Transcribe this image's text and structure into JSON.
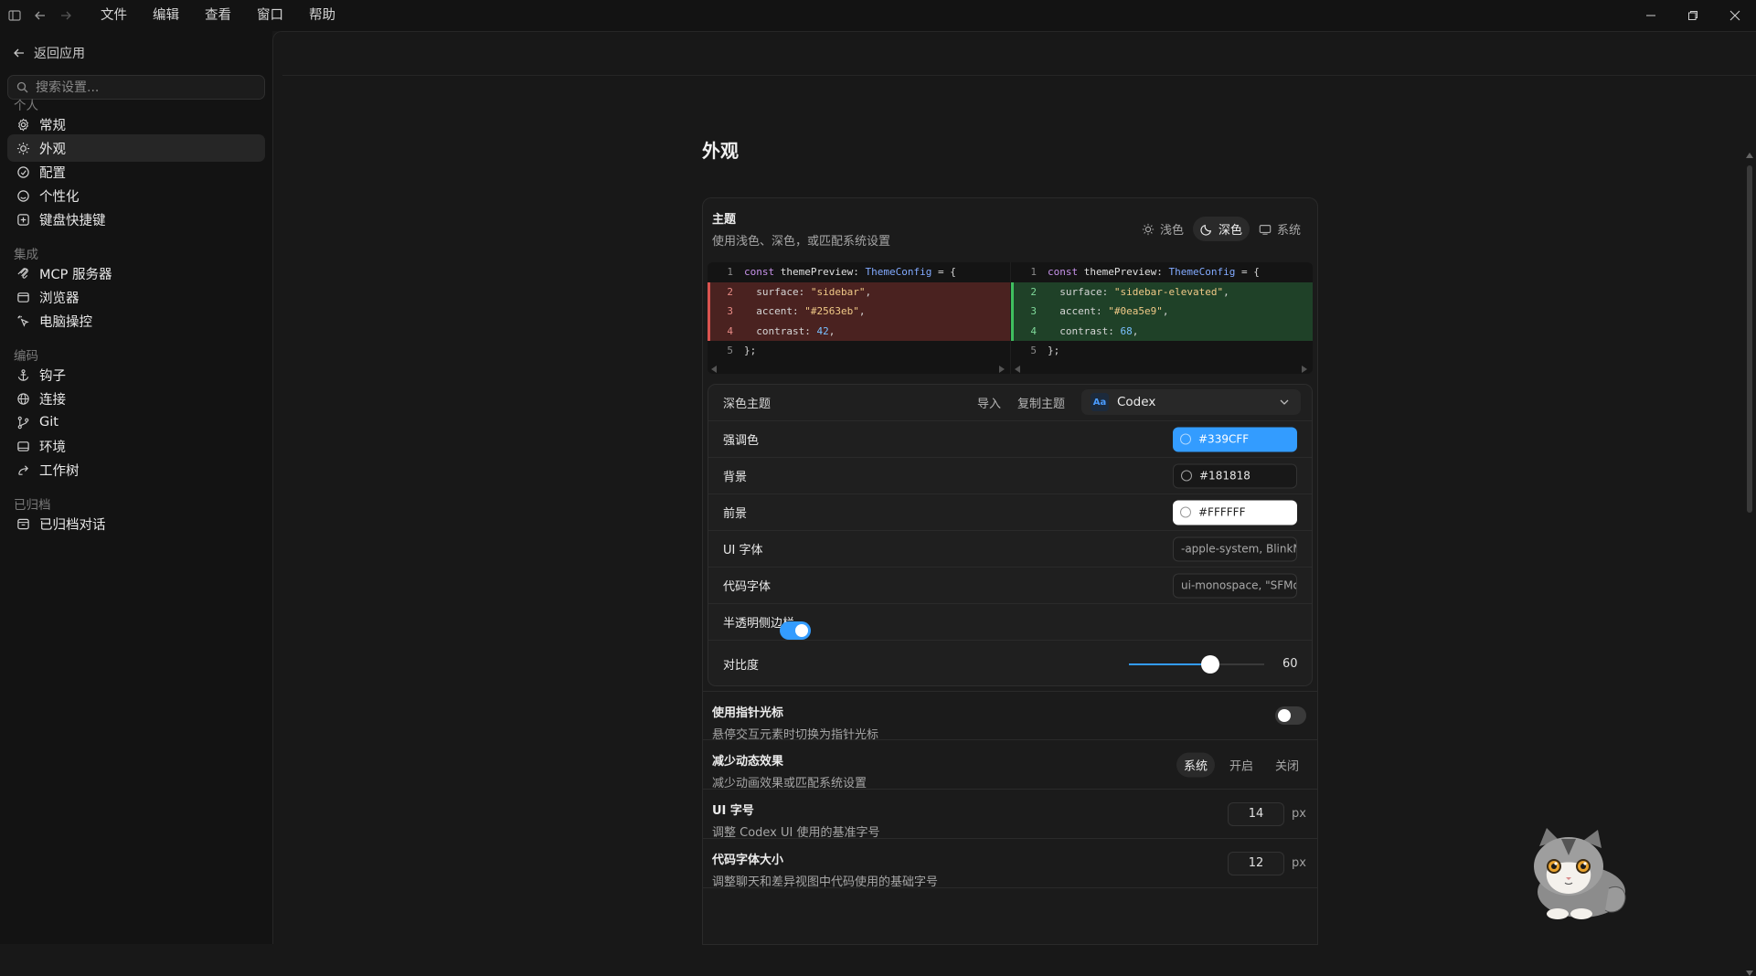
{
  "menu": {
    "items": [
      "文件",
      "编辑",
      "查看",
      "窗口",
      "帮助"
    ]
  },
  "sidebar": {
    "back_label": "返回应用",
    "search_placeholder": "搜索设置...",
    "sections": [
      {
        "label": "个人",
        "items": [
          {
            "label": "常规",
            "icon": "gear-icon"
          },
          {
            "label": "外观",
            "icon": "sun-icon",
            "active": true
          },
          {
            "label": "配置",
            "icon": "config-icon"
          },
          {
            "label": "个性化",
            "icon": "personalize-icon"
          },
          {
            "label": "键盘快捷键",
            "icon": "keyboard-icon"
          }
        ]
      },
      {
        "label": "集成",
        "items": [
          {
            "label": "MCP 服务器",
            "icon": "mcp-icon"
          },
          {
            "label": "浏览器",
            "icon": "browser-icon"
          },
          {
            "label": "电脑操控",
            "icon": "computer-control-icon"
          }
        ]
      },
      {
        "label": "编码",
        "items": [
          {
            "label": "钩子",
            "icon": "anchor-icon"
          },
          {
            "label": "连接",
            "icon": "globe-icon"
          },
          {
            "label": "Git",
            "icon": "git-branch-icon"
          },
          {
            "label": "环境",
            "icon": "environment-icon"
          },
          {
            "label": "工作树",
            "icon": "worktree-icon"
          }
        ]
      },
      {
        "label": "已归档",
        "items": [
          {
            "label": "已归档对话",
            "icon": "archive-icon"
          }
        ]
      }
    ]
  },
  "page": {
    "title": "外观"
  },
  "theme": {
    "title": "主题",
    "desc": "使用浅色、深色，或匹配系统设置",
    "modes": [
      {
        "label": "浅色",
        "icon": "sun-icon",
        "selected": false
      },
      {
        "label": "深色",
        "icon": "moon-icon",
        "selected": true
      },
      {
        "label": "系统",
        "icon": "monitor-icon",
        "selected": false
      }
    ],
    "diff": {
      "left": [
        {
          "n": "1",
          "kind": "ctx",
          "parts": [
            [
              "kw",
              "const "
            ],
            [
              "vn",
              "themePreview"
            ],
            [
              "tx",
              ": "
            ],
            [
              "ty",
              "ThemeConfig"
            ],
            [
              "tx",
              " = {"
            ]
          ]
        },
        {
          "n": "2",
          "kind": "del",
          "parts": [
            [
              "tx",
              "  surface: "
            ],
            [
              "st",
              "\"sidebar\""
            ],
            [
              "tx",
              ","
            ]
          ]
        },
        {
          "n": "3",
          "kind": "del",
          "parts": [
            [
              "tx",
              "  accent: "
            ],
            [
              "st",
              "\"#2563eb\""
            ],
            [
              "tx",
              ","
            ]
          ]
        },
        {
          "n": "4",
          "kind": "del",
          "parts": [
            [
              "tx",
              "  contrast: "
            ],
            [
              "nm",
              "42"
            ],
            [
              "tx",
              ","
            ]
          ]
        },
        {
          "n": "5",
          "kind": "ctx",
          "parts": [
            [
              "tx",
              "};"
            ]
          ]
        }
      ],
      "right": [
        {
          "n": "1",
          "kind": "ctx",
          "parts": [
            [
              "kw",
              "const "
            ],
            [
              "vn",
              "themePreview"
            ],
            [
              "tx",
              ": "
            ],
            [
              "ty",
              "ThemeConfig"
            ],
            [
              "tx",
              " = {"
            ]
          ]
        },
        {
          "n": "2",
          "kind": "add",
          "parts": [
            [
              "tx",
              "  surface: "
            ],
            [
              "st",
              "\"sidebar-elevated\""
            ],
            [
              "tx",
              ","
            ]
          ]
        },
        {
          "n": "3",
          "kind": "add",
          "parts": [
            [
              "tx",
              "  accent: "
            ],
            [
              "st",
              "\"#0ea5e9\""
            ],
            [
              "tx",
              ","
            ]
          ]
        },
        {
          "n": "4",
          "kind": "add",
          "parts": [
            [
              "tx",
              "  contrast: "
            ],
            [
              "nm",
              "68"
            ],
            [
              "tx",
              ","
            ]
          ]
        },
        {
          "n": "5",
          "kind": "ctx",
          "parts": [
            [
              "tx",
              "};"
            ]
          ]
        }
      ]
    },
    "dark_theme": {
      "label": "深色主题",
      "import_label": "导入",
      "copy_label": "复制主题",
      "selected_theme": "Codex",
      "theme_badge": "Aa",
      "accent": {
        "label": "强调色",
        "value": "#339CFF",
        "color": "#339CFF"
      },
      "background": {
        "label": "背景",
        "value": "#181818",
        "color": "#181818"
      },
      "foreground": {
        "label": "前景",
        "value": "#FFFFFF",
        "color": "#FFFFFF"
      },
      "ui_font": {
        "label": "UI 字体",
        "value": "-apple-system, BlinkMacSystemFont"
      },
      "code_font": {
        "label": "代码字体",
        "value": "ui-monospace, \"SFMono-Regular\""
      },
      "translucent_sidebar": {
        "label": "半透明侧边栏",
        "on": true
      },
      "contrast": {
        "label": "对比度",
        "value": "60",
        "fraction": 0.6
      }
    }
  },
  "pointer_cursor": {
    "title": "使用指针光标",
    "desc": "悬停交互元素时切换为指针光标",
    "on": false
  },
  "reduce_motion": {
    "title": "减少动态效果",
    "desc": "减少动画效果或匹配系统设置",
    "options": [
      "系统",
      "开启",
      "关闭"
    ],
    "selected": "系统"
  },
  "ui_font_size": {
    "title": "UI 字号",
    "desc": "调整 Codex UI 使用的基准字号",
    "value": "14",
    "unit": "px"
  },
  "code_font_size": {
    "title": "代码字体大小",
    "desc": "调整聊天和差异视图中代码使用的基础字号",
    "value": "12",
    "unit": "px"
  },
  "colors": {
    "accent": "#339CFF",
    "toggle_off": "#3a3a3a"
  }
}
